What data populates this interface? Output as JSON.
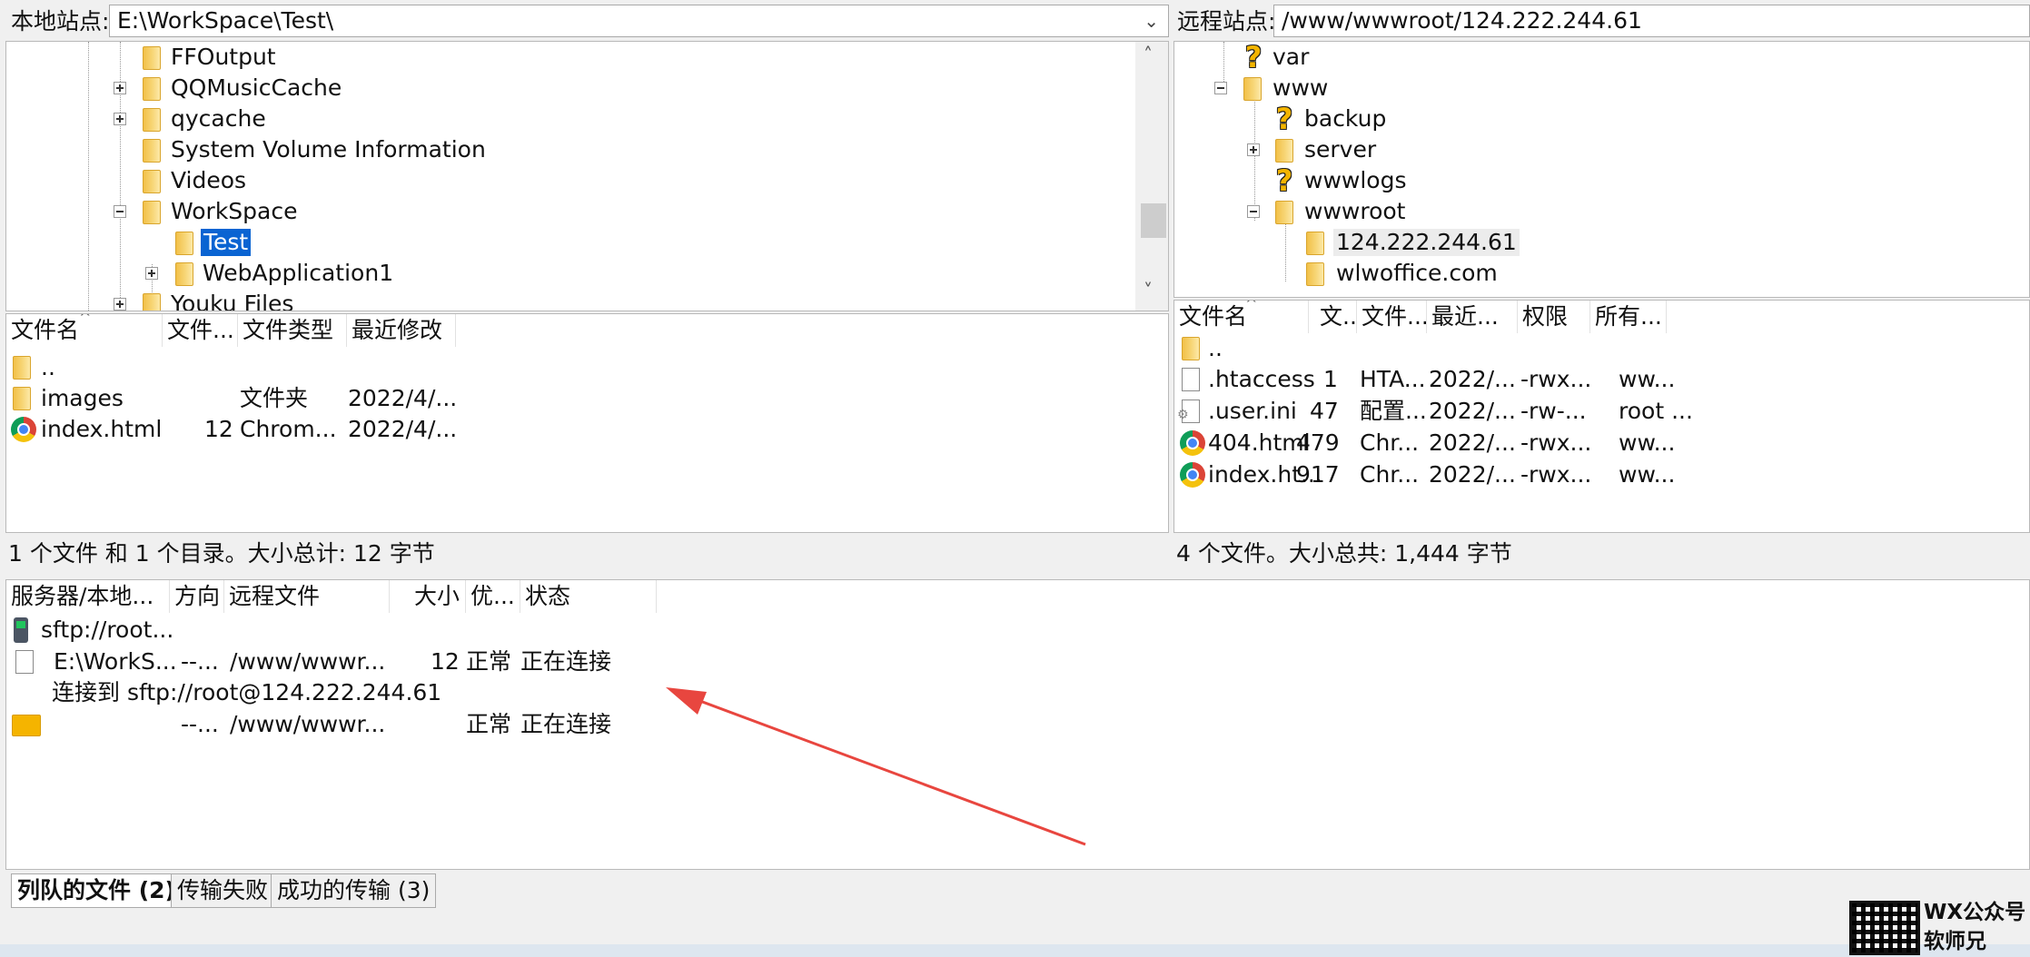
{
  "local": {
    "label": "本地站点:",
    "path": "E:\\WorkSpace\\Test\\",
    "tree": [
      "FFOutput",
      "QQMusicCache",
      "qycache",
      "System Volume Information",
      "Videos",
      "WorkSpace",
      "Test",
      "WebApplication1",
      "Youku Files"
    ],
    "columns": [
      "文件名",
      "文件...",
      "文件类型",
      "最近修改"
    ],
    "files": [
      {
        "name": "..",
        "size": "",
        "type": "",
        "modified": "",
        "icon": "folder-icon"
      },
      {
        "name": "images",
        "size": "",
        "type": "文件夹",
        "modified": "2022/4/...",
        "icon": "folder-icon"
      },
      {
        "name": "index.html",
        "size": "12",
        "type": "Chrom...",
        "modified": "2022/4/...",
        "icon": "chrome-icon"
      }
    ],
    "status": "1 个文件 和 1 个目录。大小总计: 12 字节"
  },
  "remote": {
    "label": "远程站点:",
    "path": "/www/wwwroot/124.222.244.61",
    "tree": [
      "var",
      "www",
      "backup",
      "server",
      "wwwlogs",
      "wwwroot",
      "124.222.244.61",
      "wlwoffice.com"
    ],
    "columns": [
      "文件名",
      "文...",
      "文件...",
      "最近...",
      "权限",
      "所有..."
    ],
    "files": [
      {
        "name": "..",
        "size": "",
        "type": "",
        "modified": "",
        "perm": "",
        "owner": "",
        "icon": "folder-icon"
      },
      {
        "name": ".htaccess",
        "size": "1",
        "type": "HTA...",
        "modified": "2022/...",
        "perm": "-rwx...",
        "owner": "ww...",
        "icon": "file-icon"
      },
      {
        "name": ".user.ini",
        "size": "47",
        "type": "配置...",
        "modified": "2022/...",
        "perm": "-rw-...",
        "owner": "root ...",
        "icon": "settings-file-icon"
      },
      {
        "name": "404.html",
        "size": "479",
        "type": "Chr...",
        "modified": "2022/...",
        "perm": "-rwx...",
        "owner": "ww...",
        "icon": "chrome-icon"
      },
      {
        "name": "index.ht...",
        "size": "917",
        "type": "Chr...",
        "modified": "2022/...",
        "perm": "-rwx...",
        "owner": "ww...",
        "icon": "chrome-icon"
      }
    ],
    "status": "4 个文件。大小总共: 1,444 字节"
  },
  "queue": {
    "columns": [
      "服务器/本地...",
      "方向",
      "远程文件",
      "大小",
      "优...",
      "状态"
    ],
    "server": "sftp://root...",
    "row1": {
      "local": "E:\\WorkS...",
      "dir": "--...",
      "remote": "/www/wwwr...",
      "size": "12",
      "priority": "正常",
      "status": "正在连接"
    },
    "message": "连接到 sftp://root@124.222.244.61",
    "row2": {
      "dir": "--...",
      "remote": "/www/wwwr...",
      "priority": "正常",
      "status": "正在连接"
    }
  },
  "tabs": [
    "列队的文件 (2)",
    "传输失败",
    "成功的传输 (3)"
  ],
  "watermark": {
    "line1": "WX公众号",
    "line2": "软师兄"
  },
  "colors": {
    "selection": "#0a64d2",
    "arrow": "#e8463f",
    "folder": "#f2c048"
  }
}
